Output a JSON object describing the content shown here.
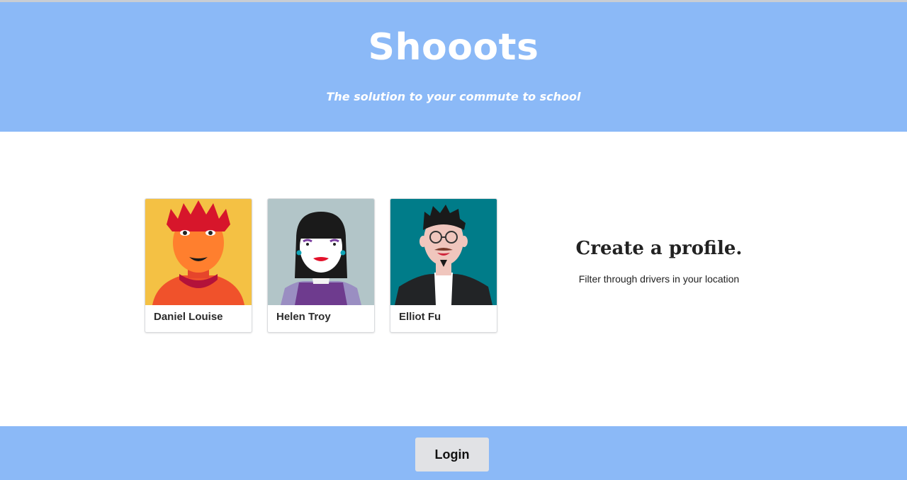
{
  "header": {
    "title": "Shooots",
    "tagline": "The solution to your commute to school"
  },
  "profiles": [
    {
      "name": "Daniel Louise",
      "bg_color": "#f4c144"
    },
    {
      "name": "Helen Troy",
      "bg_color": "#b2c5c8"
    },
    {
      "name": "Elliot Fu",
      "bg_color": "#007c89"
    }
  ],
  "promo": {
    "title": "Create a profile.",
    "text": "Filter through drivers in your location"
  },
  "footer": {
    "login_label": "Login"
  },
  "colors": {
    "header_bg": "#8bb9f7",
    "button_bg": "#e1e2e5"
  }
}
